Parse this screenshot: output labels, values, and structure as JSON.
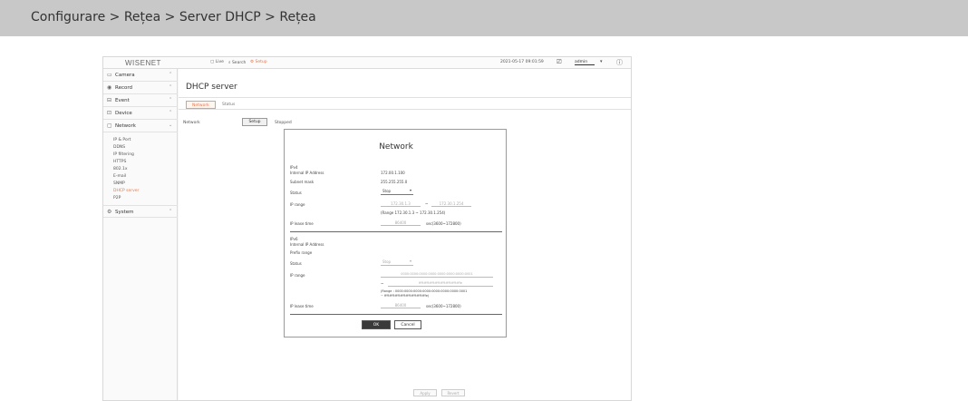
{
  "caption": "Configurare > Rețea > Server DHCP > Rețea",
  "topbar": {
    "logo": "WISENET",
    "live": "Live",
    "search": "Search",
    "setup": "Setup",
    "datetime": "2021-05-17 09:01:59",
    "user": "admin"
  },
  "sidebar": {
    "menus": [
      {
        "label": "Camera",
        "icon": "camera-icon"
      },
      {
        "label": "Record",
        "icon": "record-icon"
      },
      {
        "label": "Event",
        "icon": "event-icon"
      },
      {
        "label": "Device",
        "icon": "device-icon"
      },
      {
        "label": "Network",
        "icon": "network-icon"
      }
    ],
    "network_items": [
      "IP & Port",
      "DDNS",
      "IP filtering",
      "HTTPS",
      "802.1x",
      "E-mail",
      "SNMP",
      "DHCP server",
      "P2P"
    ],
    "system": {
      "label": "System",
      "icon": "system-icon"
    }
  },
  "main": {
    "title": "DHCP server",
    "tabs": [
      "Network",
      "Status"
    ],
    "network_label": "Network",
    "setup_button": "Setup",
    "status_text": "Stopped",
    "footer_buttons": [
      "Apply",
      "Revert"
    ]
  },
  "dialog": {
    "title": "Network",
    "ipv4": {
      "section": "IPv4",
      "internal_ip_label": "Internal IP Address",
      "internal_ip": "172.00.1.100",
      "subnet_label": "Subnet mask",
      "subnet": "255.255.255.0",
      "status_label": "Status",
      "status": "Stop",
      "ip_range_label": "IP range",
      "ip_from": "172.30.1.3",
      "ip_sep": "~",
      "ip_to": "172.30.1.254",
      "range_note": "(Range 172.30.1.3 ~ 172.30.1.254)",
      "lease_label": "IP lease time",
      "lease_value": "86400",
      "lease_unit": "sec(3600~172800)"
    },
    "ipv6": {
      "section": "IPv6",
      "internal_ip_label": "Internal IP Address",
      "prefix_label": "Prefix range",
      "status_label": "Status",
      "status": "Stop",
      "ip_range_label": "IP range",
      "ip_from": "0000:0000:0000:0000:0000:0000:0000:0001",
      "ip_sep": "~",
      "ip_to": "ffff:ffff:ffff:ffff:ffff:ffff:ffff:fffe",
      "range_note": "(Range : 0000:0000:0000:0000:0000:0000:0000:0001",
      "range_note2": "~ ffff:ffff:ffff:ffff:ffff:ffff:ffff:fffe)",
      "lease_label": "IP lease time",
      "lease_value": "86400",
      "lease_unit": "sec(3600~172800)"
    },
    "ok_label": "OK",
    "cancel_label": "Cancel"
  }
}
